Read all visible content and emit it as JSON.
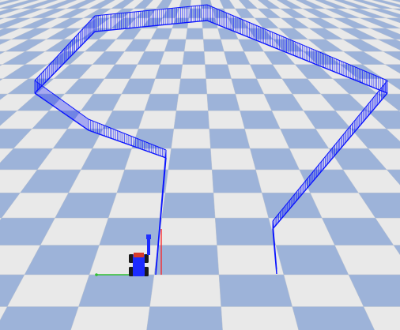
{
  "scene": {
    "colors": {
      "tile_light": "#e9e9e9",
      "tile_dark": "#9db3d9",
      "grid_line": "#b9c1cf",
      "trajectory": "#0a14ff",
      "robot_body": "#1b2bff",
      "robot_top": "#d63a2a",
      "axis_red": "#ff2020",
      "axis_green": "#30c030"
    },
    "objects": [
      {
        "name": "checkered-ground-plane",
        "type": "ground"
      },
      {
        "name": "blue-trajectory-ribbon",
        "type": "path"
      },
      {
        "name": "robot-car",
        "type": "robot"
      },
      {
        "name": "origin-axes",
        "type": "axes"
      }
    ]
  }
}
